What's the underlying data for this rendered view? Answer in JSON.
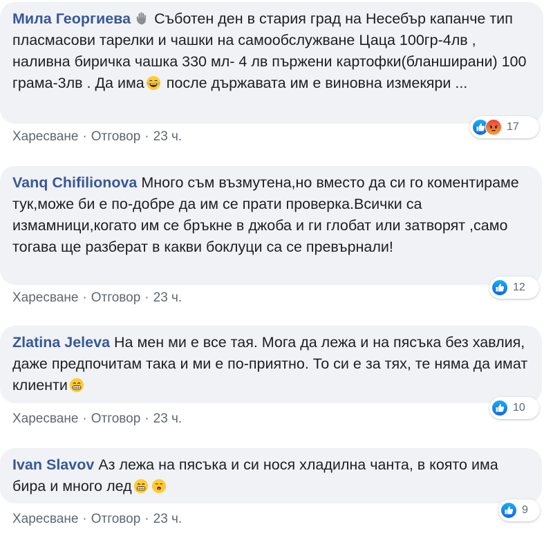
{
  "comments": [
    {
      "author": "Мила Георгиева",
      "text_line1": "Съботен ден в стария град на Несебър",
      "text_rest1": "капанче тип пласмасови тарелки и чашки на самообслужване Цаца 100гр-4лв , наливна биричка чашка 330 мл- 4 лв пържени картофки(бланширани) 100 грама-3лв . Да има",
      "text_rest2": "после държавата им е виновна измекяри ...",
      "like_label": "Харесване",
      "reply_label": "Отговор",
      "time": "23 ч.",
      "reaction_count": "17",
      "reactions": [
        "like",
        "angry"
      ]
    },
    {
      "author": "Vanq Chifilionova",
      "text": "Много съм възмутена,но вместо да си го коментираме тук,може би е по-добре да им се прати проверка.Всички са измамници,когато им се бръкне в джоба и ги глобат или затворят ,само тогава ще разберат в какви боклуци са се превърнали!",
      "like_label": "Харесване",
      "reply_label": "Отговор",
      "time": "23 ч.",
      "reaction_count": "12",
      "reactions": [
        "like"
      ]
    },
    {
      "author": "Zlatina Jeleva",
      "text": "На мен ми е все тая. Мога да лежа и на пясъка без хавлия, даже предпочитам така и ми е по-приятно. То си е за тях, те няма да имат клиенти",
      "like_label": "Харесване",
      "reply_label": "Отговор",
      "time": "23 ч.",
      "reaction_count": "10",
      "reactions": [
        "like"
      ]
    },
    {
      "author": "Ivan Slavov",
      "text": "Аз лежа на пясъка и си нося хладилна чанта, в която има бира и много лед",
      "like_label": "Харесване",
      "reply_label": "Отговор",
      "time": "23 ч.",
      "reaction_count": "9",
      "reactions": [
        "like"
      ]
    }
  ],
  "colors": {
    "bubble_bg": "#f0f2f5",
    "author": "#385898",
    "meta": "#606770",
    "like_blue": "#1877f2",
    "angry_orange": "#f0562b"
  }
}
